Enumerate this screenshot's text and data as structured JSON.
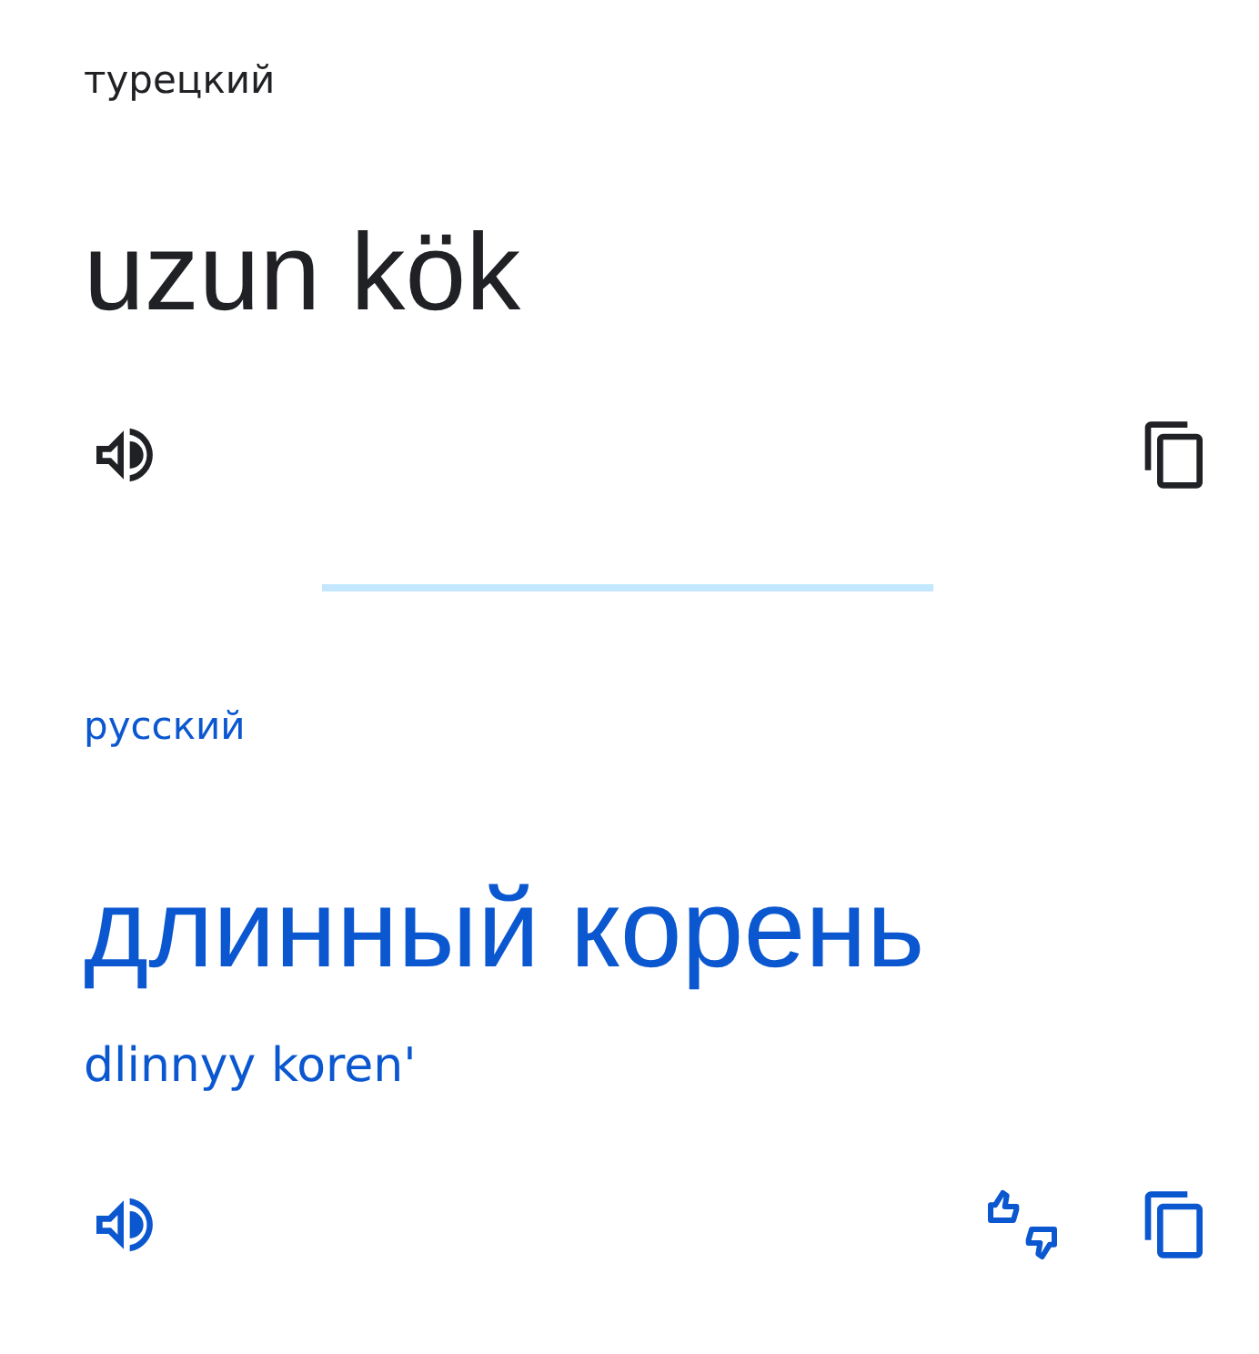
{
  "panels": [
    {
      "kind": "source",
      "language": "турецкий",
      "text": "uzun kök",
      "actions": [
        {
          "kind": "listen"
        },
        {
          "kind": "copy"
        }
      ]
    },
    {
      "kind": "target",
      "language": "русский",
      "text": "длинный корень",
      "romanization": "dlinnyy koren'",
      "actions": [
        {
          "kind": "listen"
        },
        {
          "kind": "feedback"
        },
        {
          "kind": "copy"
        }
      ]
    }
  ]
}
